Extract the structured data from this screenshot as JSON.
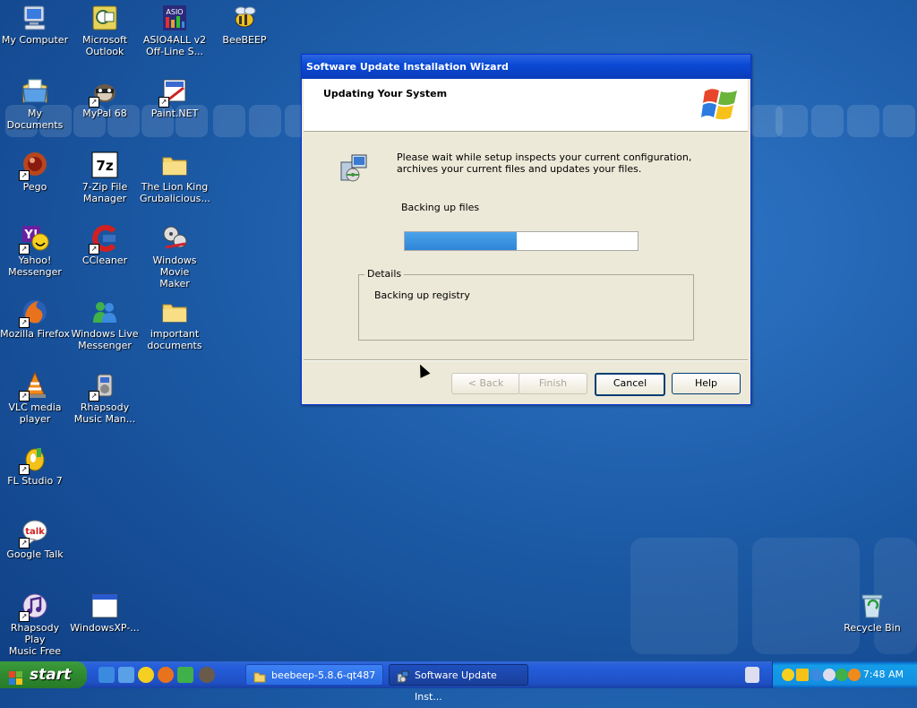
{
  "desktop": {
    "icons": [
      {
        "label": "My Computer",
        "icon": "my-computer-icon"
      },
      {
        "label": "Microsoft\nOutlook",
        "icon": "outlook-icon"
      },
      {
        "label": "ASIO4ALL v2\nOff-Line S...",
        "icon": "asio4all-icon"
      },
      {
        "label": "BeeBEEP",
        "icon": "beebeep-icon"
      },
      {
        "label": "My Documents",
        "icon": "my-documents-icon"
      },
      {
        "label": "MyPal 68",
        "icon": "mypal-icon"
      },
      {
        "label": "Paint.NET",
        "icon": "paintnet-icon"
      },
      {
        "label": "Pego",
        "icon": "pego-icon"
      },
      {
        "label": "7-Zip File\nManager",
        "icon": "7zip-icon"
      },
      {
        "label": "The Lion King\nGrubalicious...",
        "icon": "folder-icon"
      },
      {
        "label": "Yahoo!\nMessenger",
        "icon": "yahoo-messenger-icon"
      },
      {
        "label": "CCleaner",
        "icon": "ccleaner-icon"
      },
      {
        "label": "Windows Movie\nMaker",
        "icon": "movie-maker-icon"
      },
      {
        "label": "Mozilla Firefox",
        "icon": "firefox-icon"
      },
      {
        "label": "Windows Live\nMessenger",
        "icon": "live-messenger-icon"
      },
      {
        "label": "important\ndocuments",
        "icon": "folder-icon"
      },
      {
        "label": "VLC media\nplayer",
        "icon": "vlc-icon"
      },
      {
        "label": "Rhapsody\nMusic Man...",
        "icon": "rhapsody-icon"
      },
      {
        "label": "FL Studio 7",
        "icon": "fl-studio-icon"
      },
      {
        "label": "Google Talk",
        "icon": "google-talk-icon"
      },
      {
        "label": "Rhapsody Play\nMusic Free",
        "icon": "rhapsody-play-icon"
      },
      {
        "label": "WindowsXP-...",
        "icon": "window-icon"
      },
      {
        "label": "Recycle Bin",
        "icon": "recycle-bin-icon"
      }
    ]
  },
  "wizard": {
    "title": "Software Update Installation Wizard",
    "heading": "Updating Your System",
    "description": "Please wait while setup inspects your current configuration, archives your current files and updates your files.",
    "status": "Backing up files",
    "progress_fraction": 0.48,
    "details_legend": "Details",
    "details_text": "Backing up registry",
    "buttons": {
      "back": "< Back",
      "finish": "Finish",
      "cancel": "Cancel",
      "help": "Help"
    }
  },
  "taskbar": {
    "start_label": "start",
    "tasks": [
      {
        "label": "beebeep-5.8.6-qt487",
        "icon": "folder-icon"
      },
      {
        "label": "Software Update Inst...",
        "icon": "setup-icon"
      }
    ],
    "clock": "7:48 AM"
  },
  "colors": {
    "desktop": "#1d5ca8",
    "titlebar": "#0a4ad6",
    "progress_fill": "#2f86d8",
    "start_button": "#2f8a2f"
  }
}
